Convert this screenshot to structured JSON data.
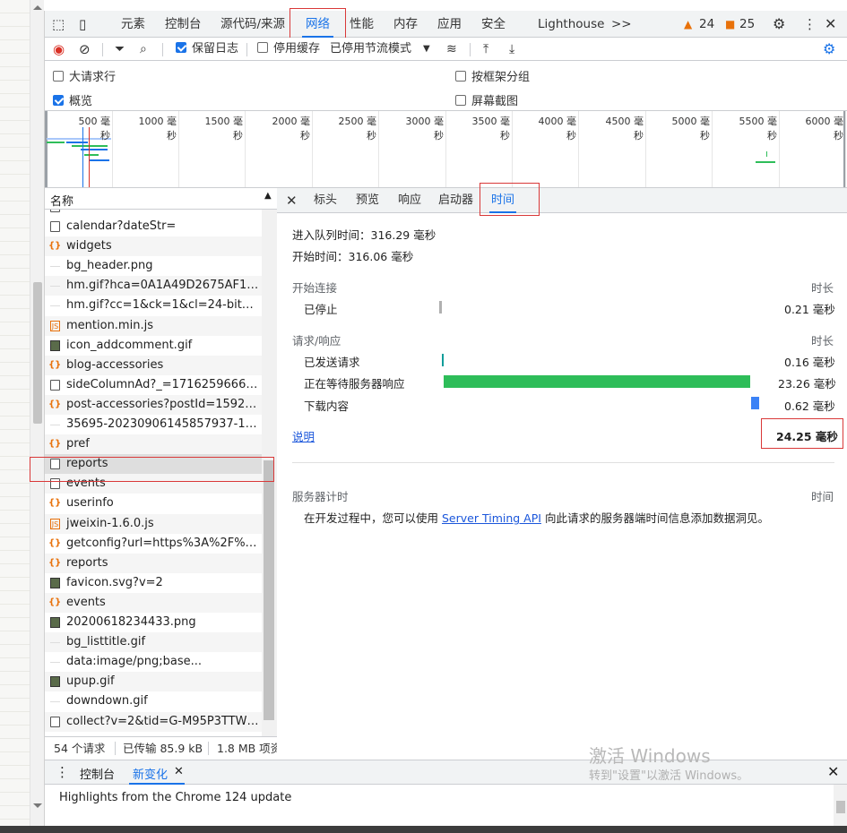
{
  "main_tabs": [
    {
      "label": "元素"
    },
    {
      "label": "控制台"
    },
    {
      "label": "源代码/来源"
    },
    {
      "label": "网络"
    },
    {
      "label": "性能"
    },
    {
      "label": "内存"
    },
    {
      "label": "应用"
    },
    {
      "label": "安全"
    },
    {
      "label": "Lighthouse"
    }
  ],
  "more_tabs": ">>",
  "warnings_count": "24",
  "issues_count": "25",
  "toolbar": {
    "preserve_log": "保留日志",
    "disable_cache": "停用缓存",
    "throttling": "已停用节流模式"
  },
  "options": {
    "big_rows": "大请求行",
    "group_by_frame": "按框架分组",
    "overview": "概览",
    "screenshots": "屏幕截图"
  },
  "overview_ticks": [
    "500 毫秒",
    "1000 毫秒",
    "1500 毫秒",
    "2000 毫秒",
    "2500 毫秒",
    "3000 毫秒",
    "3500 毫秒",
    "4000 毫秒",
    "4500 毫秒",
    "5000 毫秒",
    "5500 毫秒",
    "6000 毫秒"
  ],
  "list": {
    "header": "名称",
    "partial_top": "news",
    "rows": [
      {
        "name": "calendar?dateStr=",
        "icon": "doc"
      },
      {
        "name": "widgets",
        "icon": "xhr"
      },
      {
        "name": "bg_header.png",
        "icon": "blank"
      },
      {
        "name": "hm.gif?hca=0A1A49D2675AF186...",
        "icon": "blank"
      },
      {
        "name": "hm.gif?cc=1&ck=1&cl=24-bit&d...",
        "icon": "blank"
      },
      {
        "name": "mention.min.js",
        "icon": "js"
      },
      {
        "name": "icon_addcomment.gif",
        "icon": "img"
      },
      {
        "name": "blog-accessories",
        "icon": "xhr"
      },
      {
        "name": "sideColumnAd?_=1716259666393",
        "icon": "doc"
      },
      {
        "name": "post-accessories?postId=15928784",
        "icon": "xhr"
      },
      {
        "name": "35695-20230906145857937-1471...",
        "icon": "blank"
      },
      {
        "name": "pref",
        "icon": "xhr"
      },
      {
        "name": "reports",
        "icon": "box"
      },
      {
        "name": "events",
        "icon": "box"
      },
      {
        "name": "userinfo",
        "icon": "xhr"
      },
      {
        "name": "jweixin-1.6.0.js",
        "icon": "js"
      },
      {
        "name": "getconfig?url=https%3A%2F%2F...",
        "icon": "xhr"
      },
      {
        "name": "reports",
        "icon": "xhr"
      },
      {
        "name": "favicon.svg?v=2",
        "icon": "img"
      },
      {
        "name": "events",
        "icon": "xhr"
      },
      {
        "name": "20200618234433.png",
        "icon": "img"
      },
      {
        "name": "bg_listtitle.gif",
        "icon": "blank"
      },
      {
        "name": "data:image/png;base...",
        "icon": "blank"
      },
      {
        "name": "upup.gif",
        "icon": "img"
      },
      {
        "name": "downdown.gif",
        "icon": "blank"
      },
      {
        "name": "collect?v=2&tid=G-M95P3TTWJZ...",
        "icon": "box"
      }
    ],
    "status_requests": "54 个请求",
    "status_transferred": "已传输 85.9 kB",
    "status_resources": "1.8 MB 项资"
  },
  "detail": {
    "tabs": [
      "标头",
      "预览",
      "响应",
      "启动器",
      "时间"
    ],
    "queued_at": "进入队列时间：316.29 毫秒",
    "started_at": "开始时间：316.06 毫秒",
    "conn_section": "开始连接",
    "duration_label": "时长",
    "stalled": "已停止",
    "stalled_value": "0.21 毫秒",
    "req_section": "请求/响应",
    "request_sent": "已发送请求",
    "request_sent_value": "0.16 毫秒",
    "waiting": "正在等待服务器响应",
    "waiting_value": "23.26 毫秒",
    "download": "下载内容",
    "download_value": "0.62 毫秒",
    "explanation": "说明",
    "total": "24.25 毫秒",
    "server_timing": "服务器计时",
    "time_label": "时间",
    "server_timing_text_before": "在开发过程中，您可以使用",
    "server_timing_link": "Server Timing API",
    "server_timing_text_after": "向此请求的服务器端时间信息添加数据洞见。"
  },
  "drawer": {
    "console_tab": "控制台",
    "whats_new_tab": "新变化",
    "highlights": "Highlights from the Chrome 124 update"
  },
  "watermark": {
    "line1": "激活 Windows",
    "line2": "转到\"设置\"以激活 Windows。"
  },
  "colors": {
    "accent": "#1a73e8",
    "waiting_bar": "#2ebd59",
    "download_bar": "#3b82f6",
    "highlight_box": "#d93838"
  }
}
